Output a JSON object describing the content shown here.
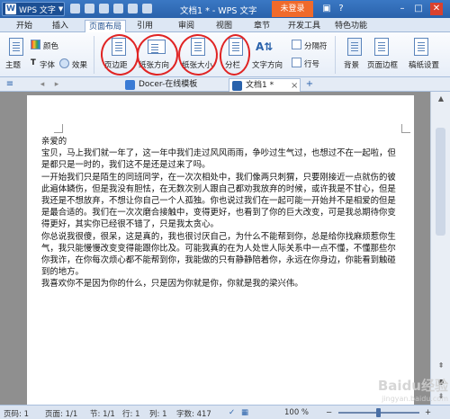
{
  "titlebar": {
    "app_menu_label": "WPS 文字",
    "window_title": "文档1 * - WPS 文字",
    "login_button": "未登录"
  },
  "tabs": [
    "开始",
    "插入",
    "页面布局",
    "引用",
    "审阅",
    "视图",
    "章节",
    "开发工具",
    "特色功能"
  ],
  "active_tab": "页面布局",
  "ribbon": {
    "theme": "主题",
    "color": "颜色",
    "font": "字体",
    "effect": "效果",
    "margins": "页边距",
    "orientation": "纸张方向",
    "size": "纸张大小",
    "columns": "分栏",
    "text_direction": "文字方向",
    "breaks": "分隔符",
    "line_numbers": "行号",
    "background": "背景",
    "page_border": "页面边框",
    "draft_paper": "稿纸设置"
  },
  "doc_tabs": [
    "Docer-在线模板",
    "文档1 *"
  ],
  "document": {
    "paragraphs": [
      "亲爱的",
      "宝贝，马上我们就一年了，这一年中我们走过风风雨雨，争吵过生气过，也想过不在一起啦，但是都只是一时的，我们这不是还是过来了吗。",
      "一开始我们只是陌生的同班同学，在一次次相处中，我们像两只刺猬，只要刚接近一点就伤的彼此遍体鳞伤，但是我没有胆怯，在无数次别人跟自己都劝我放弃的时候，或许我是不甘心，但是我还是不想放弃，不想让你自己一个人孤独。你也说过我们在一起可能一开始并不是相爱的但是是最合适的。我们在一次次磨合接触中，变得更好，也看到了你的巨大改变，可是我总期待你变得更好，其实你已经很不错了，只是我太贪心。",
      "你总说我很傻，很呆，这是真的，我也很讨厌自己，为什么不能帮到你，总是给你找麻烦惹你生气，我只能慢慢改变变得能跟你比及。可能我真的在为人处世人际关系中一点不懂，不懂那些尔你我诈，在你每次烦心都不能帮到你，我能做的只有静静陪着你，永远在你身边，你能看到触碰到的地方。",
      "我喜欢你不是因为你的什么，只是因为你就是你，你就是我的梁兴伟。"
    ]
  },
  "statusbar": {
    "page_num": "页码: 1",
    "page_of": "页面: 1/1",
    "section": "节: 1/1",
    "row": "行: 1",
    "col": "列: 1",
    "word_count": "字数: 417",
    "zoom": "100 %"
  },
  "watermark": {
    "main": "Baidu经验",
    "sub": "jingyan.baidu.com"
  },
  "colors": {
    "titlebar": "#2a62ab",
    "login": "#f06a2b",
    "annotation_circle": "#e02424"
  }
}
